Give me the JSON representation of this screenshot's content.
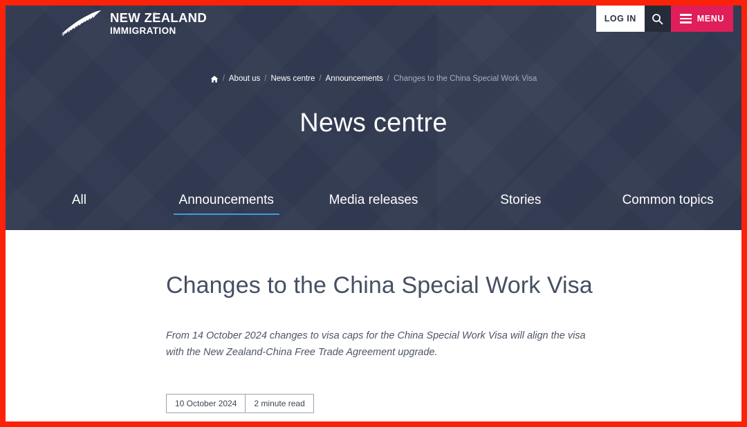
{
  "header": {
    "logo": {
      "icon": "silver-fern-icon",
      "line1": "NEW ZEALAND",
      "line2": "IMMIGRATION",
      "registered_mark": "®"
    },
    "login_label": "LOG IN",
    "search_icon": "search-icon",
    "menu_label": "MENU"
  },
  "breadcrumb": {
    "home_icon": "home-icon",
    "separator": "/",
    "items": [
      {
        "label": "About us",
        "current": false
      },
      {
        "label": "News centre",
        "current": false
      },
      {
        "label": "Announcements",
        "current": false
      },
      {
        "label": "Changes to the China Special Work Visa",
        "current": true
      }
    ]
  },
  "hero": {
    "title": "News centre"
  },
  "tabs": [
    {
      "label": "All",
      "active": false
    },
    {
      "label": "Announcements",
      "active": true
    },
    {
      "label": "Media releases",
      "active": false
    },
    {
      "label": "Stories",
      "active": false
    },
    {
      "label": "Common topics",
      "active": false
    }
  ],
  "article": {
    "title": "Changes to the China Special Work Visa",
    "intro": "From 14 October 2024 changes to visa caps for the China Special Work Visa will align the visa with the New Zealand-China Free Trade Agreement upgrade.",
    "date": "10 October 2024",
    "read_time": "2 minute read"
  },
  "colors": {
    "hero_background": "#313950",
    "menu_accent": "#e01e59",
    "active_tab_underline": "#3d9ddb",
    "annotation_border": "#fb2209",
    "content_background": "#ffffff"
  }
}
